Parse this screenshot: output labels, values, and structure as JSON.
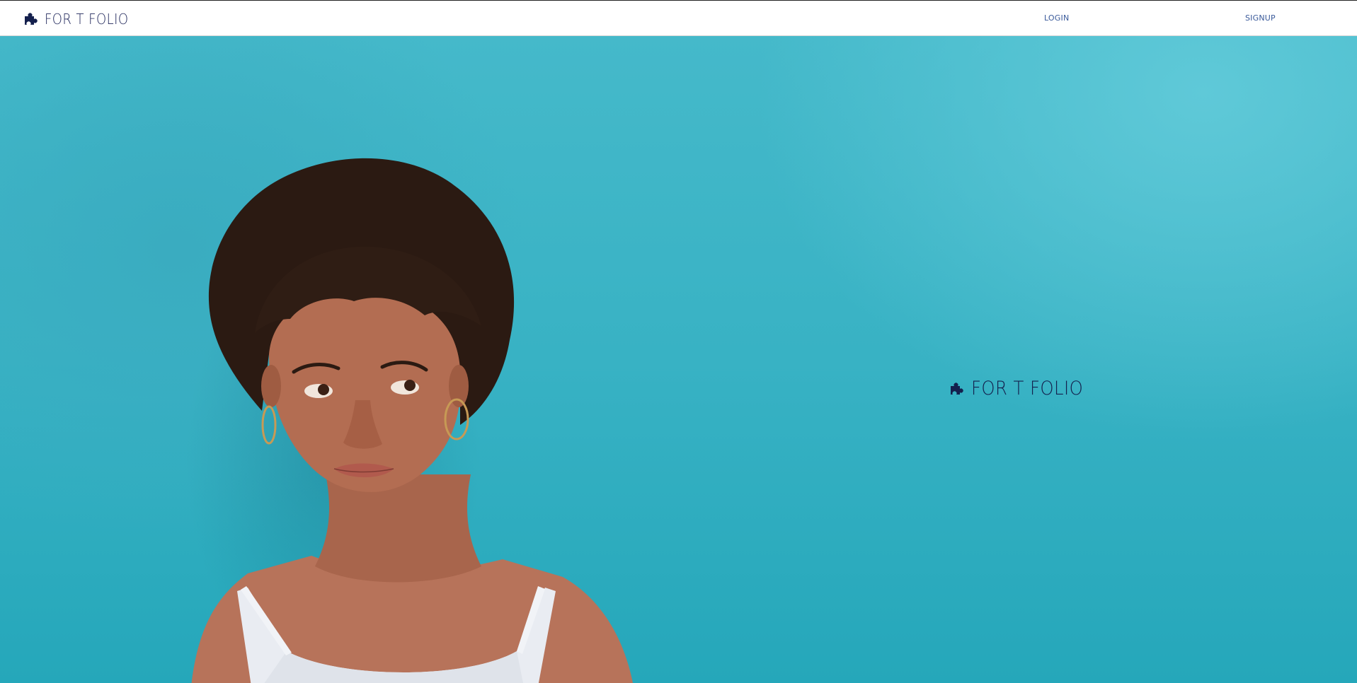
{
  "navbar": {
    "brand_name": "FOR T FOLIO",
    "brand_icon": "puzzle-piece-icon",
    "login_label": "LOGIN",
    "signup_label": "SIGNUP"
  },
  "hero": {
    "brand_name": "FOR T FOLIO",
    "brand_icon": "puzzle-piece-icon",
    "background_color": "#38b2c4",
    "brand_color": "#14204d"
  }
}
